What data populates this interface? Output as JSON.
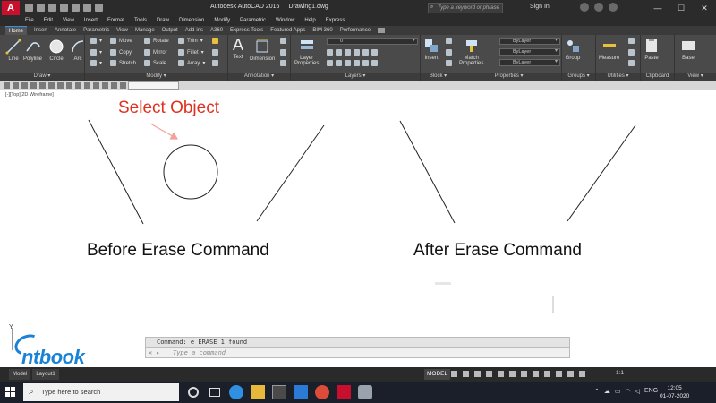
{
  "titlebar": {
    "app_title": "Autodesk AutoCAD 2016",
    "file_name": "Drawing1.dwg",
    "search_placeholder": "Type a keyword or phrase",
    "sign_in": "Sign In"
  },
  "menu": [
    "File",
    "Edit",
    "View",
    "Insert",
    "Format",
    "Tools",
    "Draw",
    "Dimension",
    "Modify",
    "Parametric",
    "Window",
    "Help",
    "Express"
  ],
  "ribbon_tabs": [
    "Home",
    "Insert",
    "Annotate",
    "Parametric",
    "View",
    "Manage",
    "Output",
    "Add-ins",
    "A360",
    "Express Tools",
    "Featured Apps",
    "BIM 360",
    "Performance"
  ],
  "ribbon": {
    "draw": {
      "label": "Draw ▾",
      "tools": [
        "Line",
        "Polyline",
        "Circle",
        "Arc"
      ]
    },
    "modify": {
      "label": "Modify ▾",
      "items": [
        "Move",
        "Rotate",
        "Trim",
        "Copy",
        "Mirror",
        "Fillet",
        "Stretch",
        "Scale",
        "Array"
      ]
    },
    "annotation": {
      "label": "Annotation ▾",
      "tools": [
        "Text",
        "Dimension"
      ]
    },
    "layers": {
      "label": "Layers ▾",
      "tool": "Layer\nProperties",
      "layer_value": "0"
    },
    "block": {
      "label": "Block ▾",
      "tool": "Insert"
    },
    "properties": {
      "label": "Properties ▾",
      "tool": "Match\nProperties",
      "color": "ByLayer",
      "linetype": "ByLayer",
      "lineweight": "ByLayer"
    },
    "groups": {
      "label": "Groups ▾",
      "tool": "Group"
    },
    "utilities": {
      "label": "Utilities ▾",
      "tool": "Measure"
    },
    "clipboard": {
      "label": "Clipboard",
      "tool": "Paste"
    },
    "view": {
      "label": "View ▾",
      "tool": "Base"
    }
  },
  "viewport": {
    "label": "[-][Top][2D Wireframe]",
    "annotation": "Select Object",
    "before_caption": "Before Erase Command",
    "after_caption": "After Erase Command"
  },
  "command": {
    "history": "Command: e ERASE 1 found",
    "placeholder": "Type a command"
  },
  "status": {
    "layout_tabs": [
      "Model",
      "Layout1"
    ],
    "model": "MODEL",
    "scale": "1:1"
  },
  "watermark": "ntbook",
  "taskbar": {
    "search_placeholder": "Type here to search",
    "lang": "ENG",
    "time": "12:05",
    "date": "01-07-2020"
  },
  "colors": {
    "accent_red": "#e0301e",
    "autocad_red": "#c8102e",
    "brand_blue": "#1a82d6"
  }
}
